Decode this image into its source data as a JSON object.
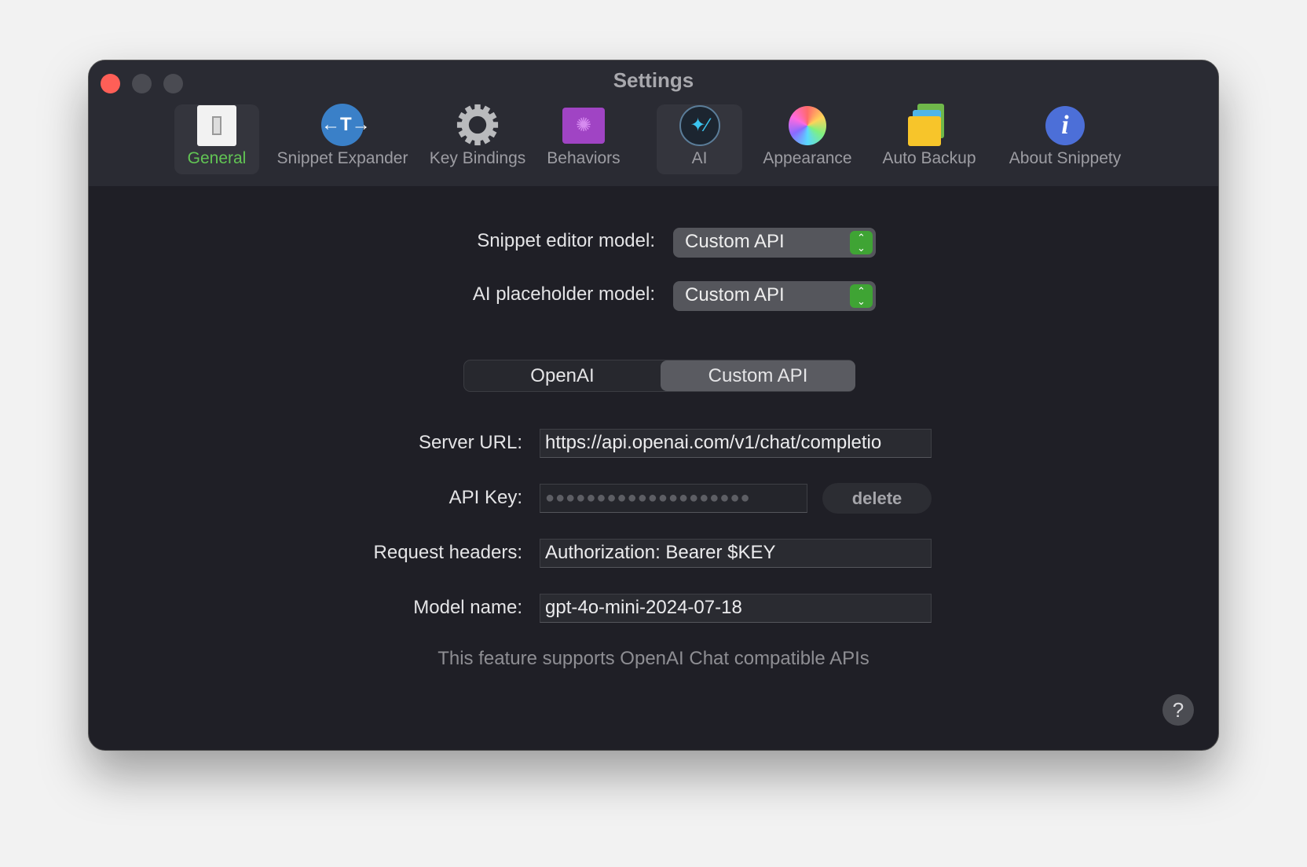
{
  "window": {
    "title": "Settings"
  },
  "toolbar": {
    "tabs": [
      {
        "label": "General",
        "icon": "light-switch-icon",
        "selected": true
      },
      {
        "label": "Snippet Expander",
        "icon": "text-expand-icon"
      },
      {
        "label": "Key Bindings",
        "icon": "gear-icon"
      },
      {
        "label": "Behaviors",
        "icon": "folder-gear-icon"
      },
      {
        "label": "AI",
        "icon": "magic-wand-icon",
        "highlighted": true
      },
      {
        "label": "Appearance",
        "icon": "color-wheel-icon"
      },
      {
        "label": "Auto Backup",
        "icon": "folders-icon"
      },
      {
        "label": "About Snippety",
        "icon": "info-icon"
      }
    ]
  },
  "models": {
    "snippet_editor_label": "Snippet editor model:",
    "snippet_editor_value": "Custom API",
    "ai_placeholder_label": "AI placeholder model:",
    "ai_placeholder_value": "Custom API"
  },
  "provider": {
    "options": [
      "OpenAI",
      "Custom API"
    ],
    "selected": "Custom API"
  },
  "form": {
    "server_url_label": "Server URL:",
    "server_url": "https://api.openai.com/v1/chat/completio",
    "api_key_label": "API Key:",
    "api_key_masked": "●●●●●●●●●●●●●●●●●●●●",
    "delete_label": "delete",
    "headers_label": "Request headers:",
    "headers": "Authorization: Bearer $KEY",
    "model_label": "Model name:",
    "model": "gpt-4o-mini-2024-07-18"
  },
  "note": "This feature supports OpenAI Chat compatible APIs",
  "help": "?",
  "colors": {
    "accent_green": "#3fa434",
    "selected_tab_text": "#62c554",
    "close": "#fe5f57"
  }
}
